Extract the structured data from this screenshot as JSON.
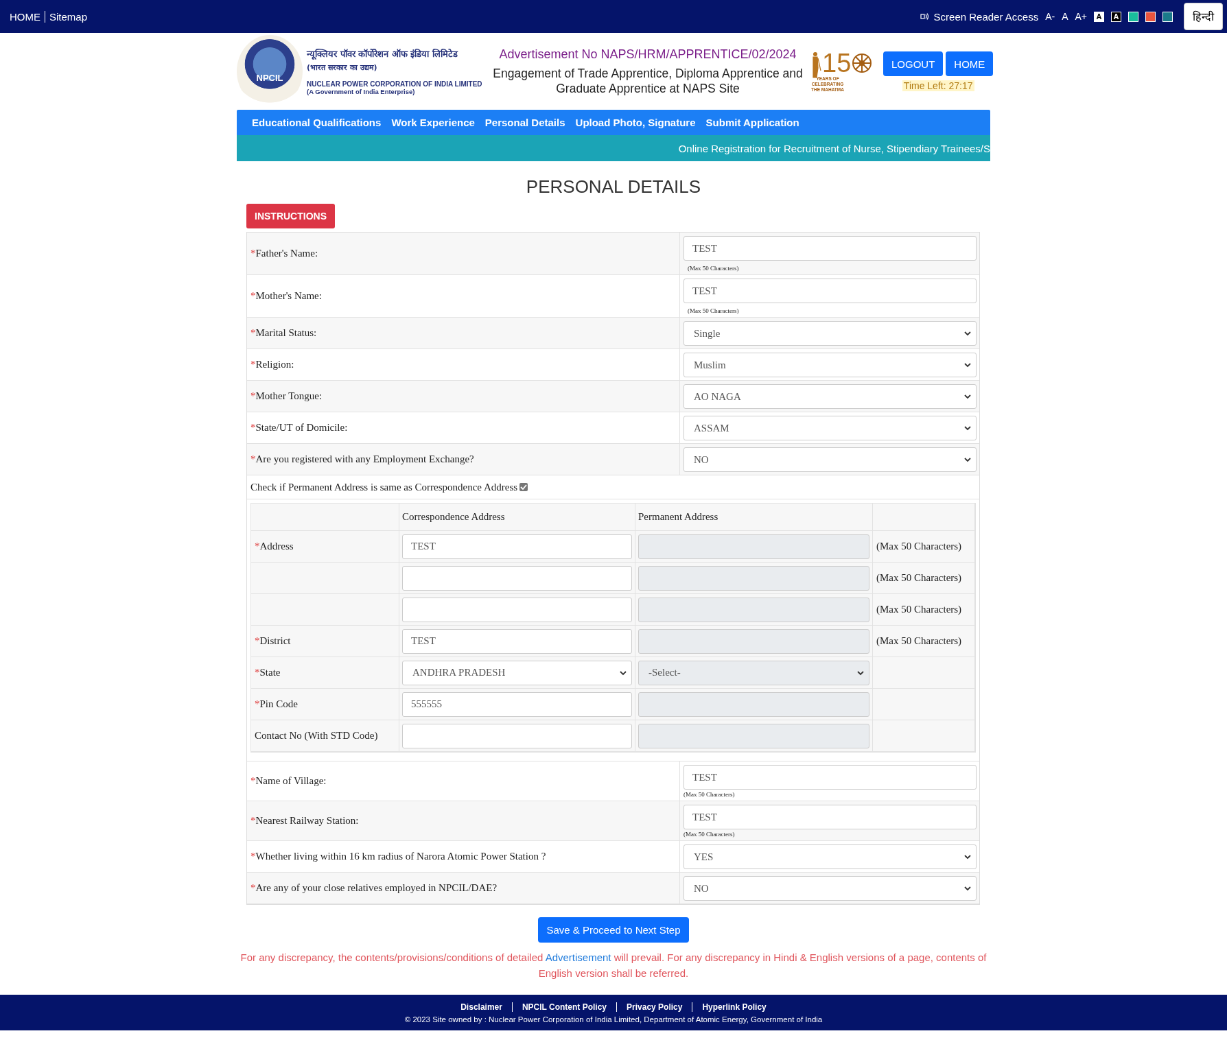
{
  "top_bar": {
    "links": [
      "HOME",
      "Sitemap"
    ],
    "screen_reader": "Screen Reader Access",
    "font_sizes": [
      "A-",
      "A",
      "A+"
    ],
    "themes": [
      {
        "label": "A",
        "color": "#ffffff"
      },
      {
        "label": "A",
        "color": "#000000"
      },
      {
        "color": "#1abc9c"
      },
      {
        "color": "#e8553e"
      },
      {
        "color": "#1a7a8a"
      }
    ],
    "language": "हिन्दी"
  },
  "header": {
    "logo_text": "NPCIL",
    "org_hindi": "न्यूक्लियर पॉवर कॉर्पोरेशन ऑफ इंडिया लिमिटेड",
    "org_hindi_sub": "(भारत सरकार का उद्यम)",
    "org_name": "NUCLEAR POWER CORPORATION OF INDIA LIMITED",
    "org_sub": "(A Government of India Enterprise)",
    "advertisement": "Advertisement No NAPS/HRM/APPRENTICE/02/2024",
    "engagement": "Engagement of Trade Apprentice, Diploma Apprentice and Graduate Apprentice at NAPS Site",
    "anniversary_number": "15",
    "anniversary_text": "YEARS OF CELEBRATING THE MAHATMA",
    "buttons": [
      "LOGOUT",
      "HOME"
    ],
    "timer": "Time Left: 27:17"
  },
  "nav": [
    "Educational Qualifications",
    "Work Experience",
    "Personal Details",
    "Upload Photo, Signature",
    "Submit Application"
  ],
  "ticker": "Online Registration for Recruitment of Nurse, Stipendiary Trainees/S",
  "page_title": "PERSONAL DETAILS",
  "instructions_button": "INSTRUCTIONS",
  "fields_top": [
    {
      "kind": "text",
      "mark": "*",
      "label": "Father's Name:",
      "value": "TEST",
      "hint": "(Max 50 Characters)"
    },
    {
      "kind": "text",
      "mark": "*",
      "label": "Mother's Name:",
      "value": "TEST",
      "hint": "(Max 50 Characters)"
    },
    {
      "kind": "select",
      "mark": "*",
      "label": "Marital Status:",
      "value": "Single"
    },
    {
      "kind": "select",
      "mark": "*",
      "label": "Religion:",
      "value": "Muslim"
    },
    {
      "kind": "select",
      "mark": "*",
      "label": "Mother Tongue:",
      "value": "AO NAGA"
    },
    {
      "kind": "select",
      "mark": "*",
      "label": "State/UT of Domicile:",
      "value": "ASSAM"
    },
    {
      "kind": "select",
      "mark": "*",
      "label": "Are you registered with any Employment Exchange?",
      "value": "NO"
    }
  ],
  "same_address": {
    "label": "Check if Permanent Address is same as Correspondence Address",
    "checked": true
  },
  "address_table": {
    "columns": {
      "correspondence": "Correspondence Address",
      "permanent": "Permanent Address"
    },
    "rows": [
      {
        "mark": "*",
        "label": "Address",
        "correspondence": {
          "kind": "text",
          "value": "TEST"
        },
        "permanent": {
          "kind": "text",
          "disabled": true
        },
        "note": "(Max 50 Characters)"
      },
      {
        "correspondence": {
          "kind": "text"
        },
        "permanent": {
          "kind": "text",
          "disabled": true
        },
        "note": "(Max 50 Characters)"
      },
      {
        "correspondence": {
          "kind": "text"
        },
        "permanent": {
          "kind": "text",
          "disabled": true
        },
        "note": "(Max 50 Characters)"
      },
      {
        "mark": "*",
        "label": "District",
        "correspondence": {
          "kind": "text",
          "value": "TEST"
        },
        "permanent": {
          "kind": "text",
          "disabled": true
        },
        "note": "(Max 50 Characters)"
      },
      {
        "mark": "*",
        "label": "State",
        "correspondence": {
          "kind": "select",
          "value": "ANDHRA PRADESH"
        },
        "permanent": {
          "kind": "select",
          "value": "-Select-",
          "disabled": true
        }
      },
      {
        "mark": "*",
        "label": "Pin Code",
        "correspondence": {
          "kind": "text",
          "value": "555555"
        },
        "permanent": {
          "kind": "text",
          "disabled": true
        }
      },
      {
        "label": "Contact No (With STD Code)",
        "correspondence": {
          "kind": "text"
        },
        "permanent": {
          "kind": "text",
          "disabled": true
        }
      }
    ]
  },
  "fields_bottom": [
    {
      "kind": "text",
      "mark": "*",
      "label": "Name of Village:",
      "value": "TEST",
      "hint": "(Max 50 Characters)"
    },
    {
      "kind": "text",
      "mark": "*",
      "label": "Nearest Railway Station:",
      "value": "TEST",
      "hint": "(Max 50 Characters)"
    },
    {
      "kind": "select",
      "mark": "*",
      "label": "Whether living within 16 km radius of Narora Atomic Power Station ?",
      "value": "YES"
    },
    {
      "kind": "select",
      "mark": "*",
      "label": "Are any of your close relatives employed in NPCIL/DAE?",
      "value": "NO"
    }
  ],
  "submit_button": "Save & Proceed to Next Step",
  "disclaimer": {
    "before": "For any discrepancy, the contents/provisions/conditions of detailed ",
    "link": "Advertisement",
    "after": " will prevail. For any discrepancy in Hindi & English versions of a page, contents of English version shall be referred."
  },
  "footer": {
    "links": [
      "Disclaimer",
      "NPCIL Content Policy",
      "Privacy Policy",
      "Hyperlink Policy"
    ],
    "copyright": "© 2023 Site owned by : Nuclear Power Corporation of India Limited, Department of Atomic Energy, Government of India"
  }
}
